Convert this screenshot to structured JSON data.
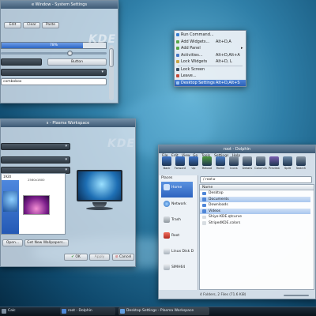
{
  "settings_window": {
    "title": "e Window - System Settings",
    "toolbar_buttons": [
      "Edit",
      "Clear",
      "Paste"
    ],
    "progress_label": "78%",
    "progress_value": 0.78,
    "button_label": "Button",
    "combobox_value": "combobox"
  },
  "kde_logo_text": "KDE",
  "desktop_menu": {
    "items": [
      {
        "label": "Run Command...",
        "shortcut": ""
      },
      {
        "label": "Add Widgets...",
        "shortcut": "Alt+D,A"
      },
      {
        "label": "Add Panel",
        "shortcut": "▸"
      },
      {
        "label": "Activities...",
        "shortcut": "Alt+D,Alt+A"
      },
      {
        "label": "Lock Widgets",
        "shortcut": "Alt+D, L"
      },
      {
        "label": "Lock Screen",
        "shortcut": ""
      },
      {
        "label": "Leave...",
        "shortcut": ""
      },
      {
        "label": "Desktop Settings",
        "shortcut": "Alt+D,Alt+S"
      }
    ]
  },
  "wallpaper_window": {
    "title": "s - Plasma Workspace",
    "list_size_top": "1920",
    "list_size_item": "2560x1600",
    "open_button": "Open...",
    "get_new_button": "Get New Wallpapers...",
    "ok_button": "OK",
    "apply_button": "Apply",
    "cancel_button": "Cancel"
  },
  "dolphin": {
    "title": "root - Dolphin",
    "menu": [
      "File",
      "Edit",
      "View",
      "Go",
      "Tools",
      "Settings",
      "Help"
    ],
    "toolbar": [
      "Back",
      "Forward",
      "Up",
      "Reload",
      "Home",
      "Icons",
      "Details",
      "Columns",
      "Preview",
      "Split",
      "Search"
    ],
    "places_header": "Places",
    "places": [
      "Home",
      "Network",
      "Trash",
      "Root",
      "Linux Disk D",
      "SIMH64"
    ],
    "breadcrumb": "/ root ▸",
    "column_name": "Name",
    "files": [
      {
        "name": "Desktop",
        "selected": false
      },
      {
        "name": "Documents",
        "selected": true
      },
      {
        "name": "Downloads",
        "selected": false
      },
      {
        "name": "Videos",
        "selected": true
      },
      {
        "name": "Shiyo-KDE.qtcurve",
        "selected": false
      },
      {
        "name": "StripedKDE.colors",
        "selected": false
      }
    ],
    "status": "4 Folders, 2 Files (71.6 KiB)"
  },
  "taskbar": {
    "tasks": [
      "Calc",
      "root - Dolphin",
      "Desktop Settings - Plasma Workspace"
    ]
  },
  "colors": {
    "accent": "#3a7bd5",
    "selection": "#2f6fc9",
    "desktop": "#2f7fa8"
  }
}
